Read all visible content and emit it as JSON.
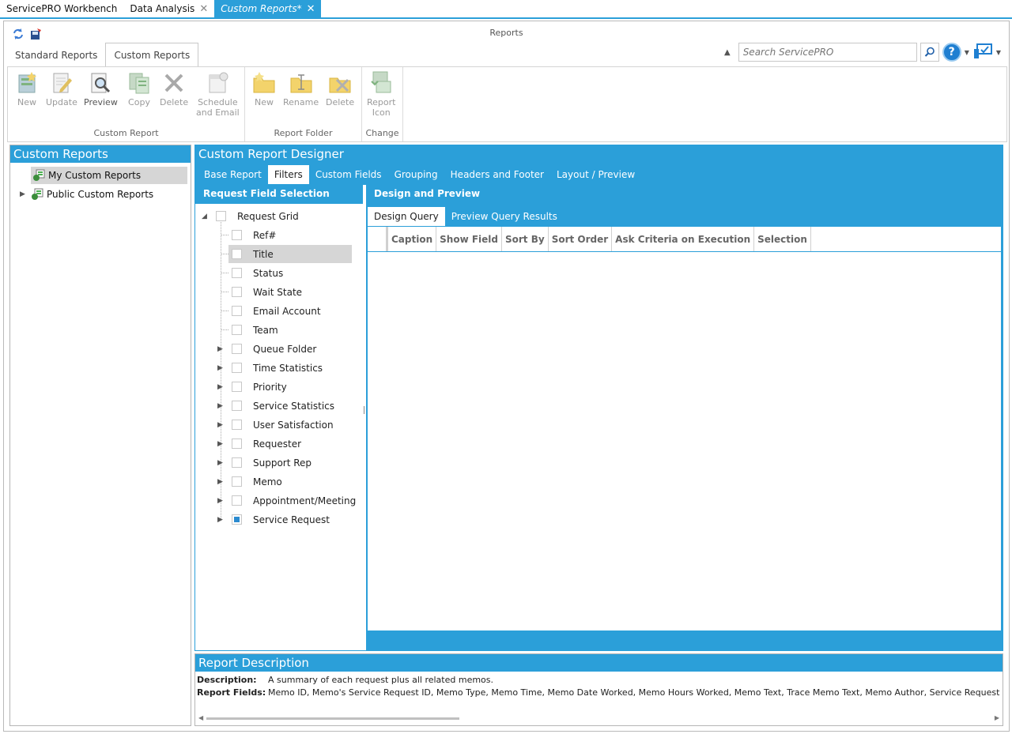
{
  "doc_tabs": [
    {
      "label": "ServicePRO Workbench",
      "closable": false,
      "active": false
    },
    {
      "label": "Data Analysis",
      "closable": true,
      "active": false
    },
    {
      "label": "Custom Reports*",
      "closable": true,
      "active": true
    }
  ],
  "ribbon": {
    "title": "Reports",
    "tabs": [
      "Standard Reports",
      "Custom Reports"
    ],
    "search_placeholder": "Search ServicePRO",
    "help_label": "?",
    "groups": {
      "custom_report": {
        "label": "Custom Report",
        "buttons": {
          "new": "New",
          "update": "Update",
          "preview": "Preview",
          "copy": "Copy",
          "delete": "Delete",
          "schedule_1": "Schedule",
          "schedule_2": "and Email"
        }
      },
      "report_folder": {
        "label": "Report Folder",
        "buttons": {
          "new": "New",
          "rename": "Rename",
          "delete": "Delete"
        }
      },
      "change": {
        "label": "Change",
        "buttons": {
          "report_icon_1": "Report",
          "report_icon_2": "Icon"
        }
      }
    }
  },
  "left_panel": {
    "title": "Custom Reports",
    "items": [
      "My Custom Reports",
      "Public Custom Reports"
    ]
  },
  "designer": {
    "title": "Custom Report Designer",
    "tabs": [
      "Base Report",
      "Filters",
      "Custom Fields",
      "Grouping",
      "Headers and Footer",
      "Layout / Preview"
    ],
    "field_panel_title": "Request Field Selection",
    "root": "Request Grid",
    "fields": [
      "Ref#",
      "Title",
      "Status",
      "Wait State",
      "Email Account",
      "Team",
      "Queue Folder",
      "Time Statistics",
      "Priority",
      "Service Statistics",
      "User Satisfaction",
      "Requester",
      "Support Rep",
      "Memo",
      "Appointment/Meeting",
      "Service Request"
    ],
    "design_panel_title": "Design and Preview",
    "query_tabs": [
      "Design Query",
      "Preview Query Results"
    ],
    "grid_columns": [
      "Caption",
      "Show Field",
      "Sort By",
      "Sort Order",
      "Ask Criteria on Execution",
      "Selection"
    ]
  },
  "description": {
    "title": "Report Description",
    "description_label": "Description:",
    "description_value": "A summary of each request plus all related memos.",
    "fields_label": "Report Fields:",
    "fields_value": "Memo ID, Memo's Service Request ID, Memo Type, Memo Time, Memo Date Worked, Memo Hours Worked, Memo Text, Trace Memo Text, Memo Author, Service Request"
  }
}
